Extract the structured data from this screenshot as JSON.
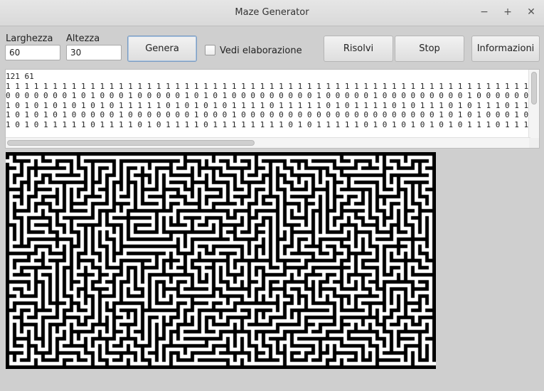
{
  "window": {
    "title": "Maze Generator",
    "controls": {
      "minimize": "−",
      "maximize": "+",
      "close": "✕"
    }
  },
  "form": {
    "width_label": "Larghezza",
    "width_value": "60",
    "height_label": "Altezza",
    "height_value": "30",
    "generate_label": "Genera",
    "show_processing_label": "Vedi elaborazione",
    "show_processing_checked": false,
    "solve_label": "Risolvi",
    "stop_label": "Stop",
    "info_label": "Informazioni"
  },
  "output": {
    "lines": [
      "121 61",
      "1 1 1 1 1 1 1 1 1 1 1 1 1 1 1 1 1 1 1 1 1 1 1 1 1 1 1 1 1 1 1 1 1 1 1 1 1 1 1 1 1 1 1 1 1 1 1 1 1 1 1 1 1 1 1 1 1 1 1 1 1",
      "0 0 0 0 0 0 0 1 0 1 0 0 0 1 0 0 0 0 0 1 0 1 0 1 0 0 0 0 0 0 0 0 0 1 0 0 0 0 0 1 0 0 0 0 0 0 0 0 0 1 0 0 0 0 0 0 0 1 0 0",
      "1 0 1 0 1 0 1 0 1 0 1 0 1 1 1 1 1 0 1 0 1 0 1 0 1 1 1 1 0 1 1 1 1 1 0 1 0 1 1 1 1 0 1 0 1 1 1 0 1 0 1 1 1 0 1 1 1 0 1 0 1",
      "1 0 1 0 1 0 1 0 0 0 0 0 1 0 0 0 0 0 0 0 1 0 0 0 1 0 0 0 0 0 0 0 0 0 0 0 0 0 0 0 0 0 0 0 0 0 1 0 1 0 1 0 0 0 1 0 0 0 1 0 0",
      "1 0 1 0 1 1 1 1 1 0 1 1 1 1 0 1 0 1 1 1 1 0 1 1 1 1 1 1 1 1 0 1 0 1 1 1 1 1 0 1 0 1 0 1 0 1 0 1 0 1 1 1 0 1 1 1 0 1 1 1 1"
    ]
  },
  "maze": {
    "cols": 121,
    "rows": 61,
    "wall_color": "#000000",
    "path_color": "#ffffff"
  }
}
